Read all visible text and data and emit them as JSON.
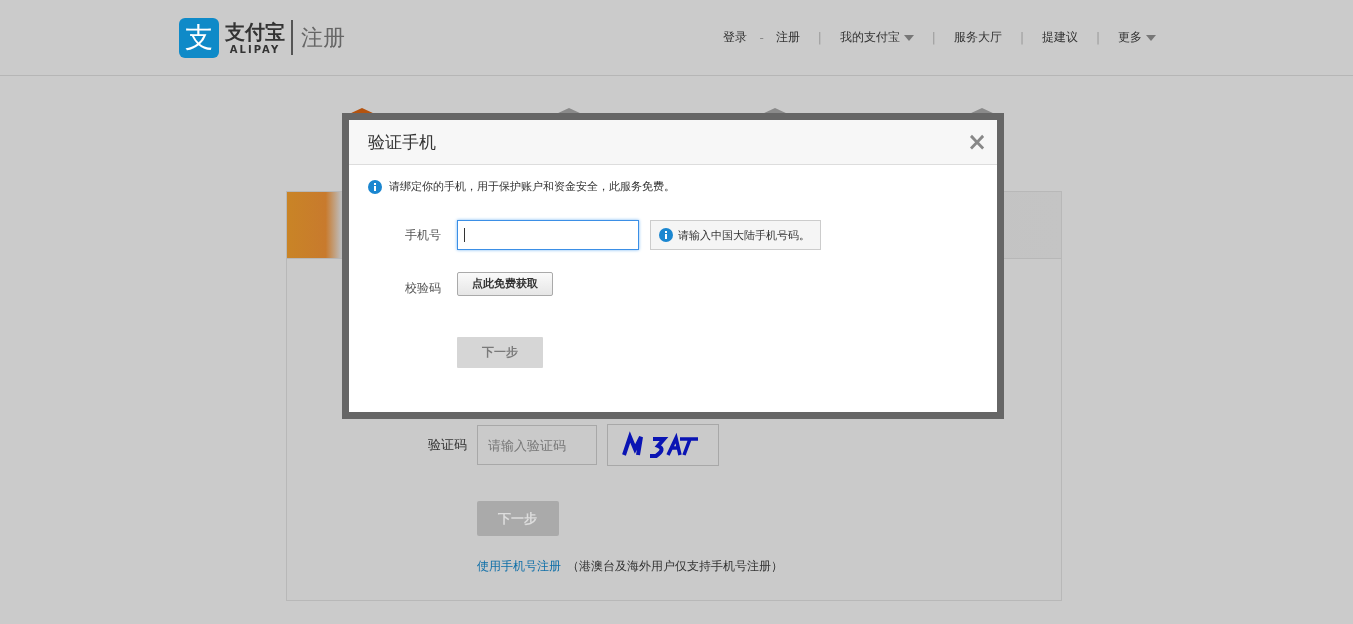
{
  "header": {
    "logo_mark": "支",
    "logo_name": "支付宝",
    "logo_sub": "ALIPAY",
    "page_title": "注册",
    "nav": [
      {
        "label": "登录",
        "separator": "-",
        "dropdown": false
      },
      {
        "label": "注册",
        "separator": "|",
        "dropdown": false
      },
      {
        "label": "我的支付宝",
        "separator": "|",
        "dropdown": true
      },
      {
        "label": "服务大厅",
        "separator": "|",
        "dropdown": false
      },
      {
        "label": "提建议",
        "separator": "|",
        "dropdown": false
      },
      {
        "label": "更多",
        "dropdown": true
      }
    ]
  },
  "steps": [
    {
      "selected": true
    },
    {
      "selected": false
    },
    {
      "selected": false
    },
    {
      "selected": false
    }
  ],
  "form": {
    "captcha_label": "验证码",
    "captcha_placeholder": "请输入验证码",
    "next_button": "下一步",
    "phone_link": "使用手机号注册",
    "phone_note": "（港澳台及海外用户仅支持手机号注册）"
  },
  "dialog": {
    "title": "验证手机",
    "close": "×",
    "notice": "请绑定你的手机，用于保护账户和资金安全，此服务免费。",
    "phone_label": "手机号",
    "phone_tip": "请输入中国大陆手机号码。",
    "code_label": "校验码",
    "code_button": "点此免费获取",
    "next_button": "下一步",
    "next_disabled": true
  }
}
